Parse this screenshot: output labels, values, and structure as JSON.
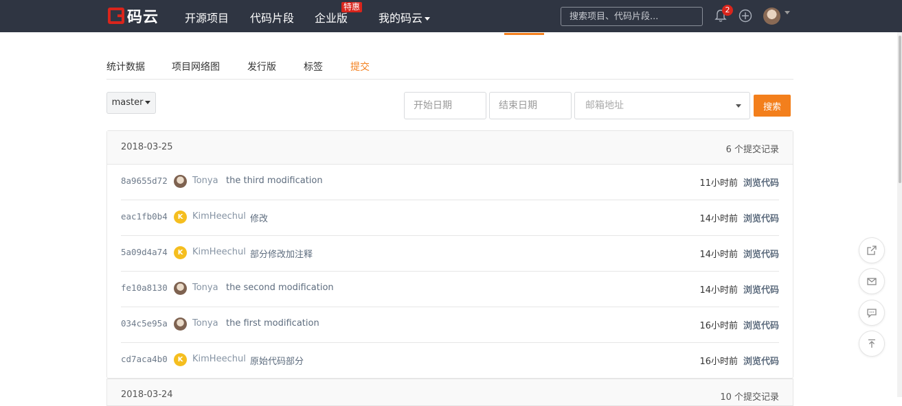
{
  "navbar": {
    "logo_text": "码云",
    "items": [
      {
        "label": "开源项目"
      },
      {
        "label": "代码片段"
      },
      {
        "label": "企业版"
      },
      {
        "label": "我的码云"
      }
    ],
    "enterprise_badge": "特惠",
    "search_placeholder": "搜索项目、代码片段...",
    "notification_count": "2"
  },
  "tabs": [
    {
      "label": "统计数据",
      "active": false
    },
    {
      "label": "项目网络图",
      "active": false
    },
    {
      "label": "发行版",
      "active": false
    },
    {
      "label": "标签",
      "active": false
    },
    {
      "label": "提交",
      "active": true
    }
  ],
  "filters": {
    "branch": "master",
    "start_date_placeholder": "开始日期",
    "end_date_placeholder": "结束日期",
    "email_placeholder": "邮箱地址",
    "search_button": "搜索"
  },
  "groups": [
    {
      "date": "2018-03-25",
      "count": "6 个提交记录",
      "commits": [
        {
          "sha": "8a9655d72",
          "avatar": "photo",
          "author": "Tonya",
          "message": "the third modification",
          "time": "11小时前",
          "browse": "浏览代码"
        },
        {
          "sha": "eac1fb0b4",
          "avatar": "K",
          "author": "KimHeechul",
          "message": "修改",
          "time": "14小时前",
          "browse": "浏览代码"
        },
        {
          "sha": "5a09d4a74",
          "avatar": "K",
          "author": "KimHeechul",
          "message": "部分修改加注释",
          "time": "14小时前",
          "browse": "浏览代码"
        },
        {
          "sha": "fe10a8130",
          "avatar": "photo",
          "author": "Tonya",
          "message": "the second modification",
          "time": "14小时前",
          "browse": "浏览代码"
        },
        {
          "sha": "034c5e95a",
          "avatar": "photo",
          "author": "Tonya",
          "message": "the first modification",
          "time": "16小时前",
          "browse": "浏览代码"
        },
        {
          "sha": "cd7aca4b0",
          "avatar": "K",
          "author": "KimHeechul",
          "message": "原始代码部分",
          "time": "16小时前",
          "browse": "浏览代码"
        }
      ]
    },
    {
      "date": "2018-03-24",
      "count": "10 个提交记录"
    }
  ],
  "side_buttons": [
    "share-icon",
    "mail-icon",
    "comment-icon",
    "back-to-top-icon"
  ],
  "colors": {
    "navbar_bg": "#2f3542",
    "accent": "#f37f1c",
    "brand_red": "#d9251c",
    "avatar_k": "#f5be1f"
  }
}
